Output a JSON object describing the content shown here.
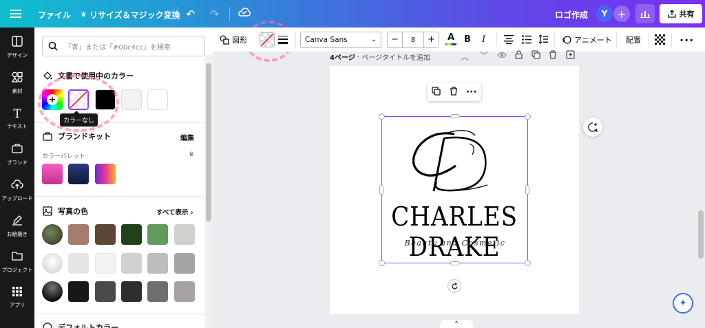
{
  "topbar": {
    "file": "ファイル",
    "resize": "リサイズ＆マジック変換",
    "logo_create": "ロゴ作成",
    "avatar_initial": "Y",
    "share": "共有"
  },
  "rail": {
    "items": [
      {
        "label": "デザイン",
        "icon": "design-icon"
      },
      {
        "label": "素材",
        "icon": "elements-icon"
      },
      {
        "label": "テキスト",
        "icon": "text-icon"
      },
      {
        "label": "ブランド",
        "icon": "brand-icon"
      },
      {
        "label": "アップロード",
        "icon": "upload-icon"
      },
      {
        "label": "お絵描き",
        "icon": "draw-icon"
      },
      {
        "label": "プロジェクト",
        "icon": "folder-icon"
      },
      {
        "label": "アプリ",
        "icon": "apps-icon"
      }
    ]
  },
  "panel": {
    "search_placeholder": "「青」または「#00c4cc」を検索",
    "doc_colors_title": "文書で使用中のカラー",
    "brand_kit_title": "ブランドキット",
    "edit": "編集",
    "palette_label": "カラーパレット",
    "photo_colors_title": "写真の色",
    "show_all": "すべて表示",
    "default_colors_title": "デフォルトカラー",
    "tooltip": "カラーなし"
  },
  "ctxbar": {
    "shape": "図形",
    "font": "Canva Sans",
    "font_size": "8",
    "animate": "アニメート",
    "position": "配置"
  },
  "page_header": {
    "page_label": "4ページ",
    "title_placeholder": "ページタイトルを追加"
  },
  "design": {
    "monogram": "CD",
    "name": "CHARLES DRAKE",
    "tagline": "Beauty and Cosmetic"
  },
  "colors": {
    "accent": "#8b3dff",
    "doc_swatches": [
      "#ffffff",
      "#000000",
      "#f2f2f2",
      "#ffffff"
    ],
    "palette": [
      "#e64fb5",
      "#1c2957",
      "#f0a030"
    ],
    "photo_colors": [
      [
        "#a47c6b",
        "#5e4636",
        "#21411b",
        "#5f9b5a",
        "#d1d0cc"
      ],
      [
        "#e6e6e6",
        "#f3f3f3",
        "#d1d1d1",
        "#bdbdbd",
        "#a5a5a5"
      ],
      [
        "#1a1616",
        "#4a4a4a",
        "#2d2d2d",
        "#6e6e6e",
        "#a7a3a3"
      ]
    ]
  }
}
